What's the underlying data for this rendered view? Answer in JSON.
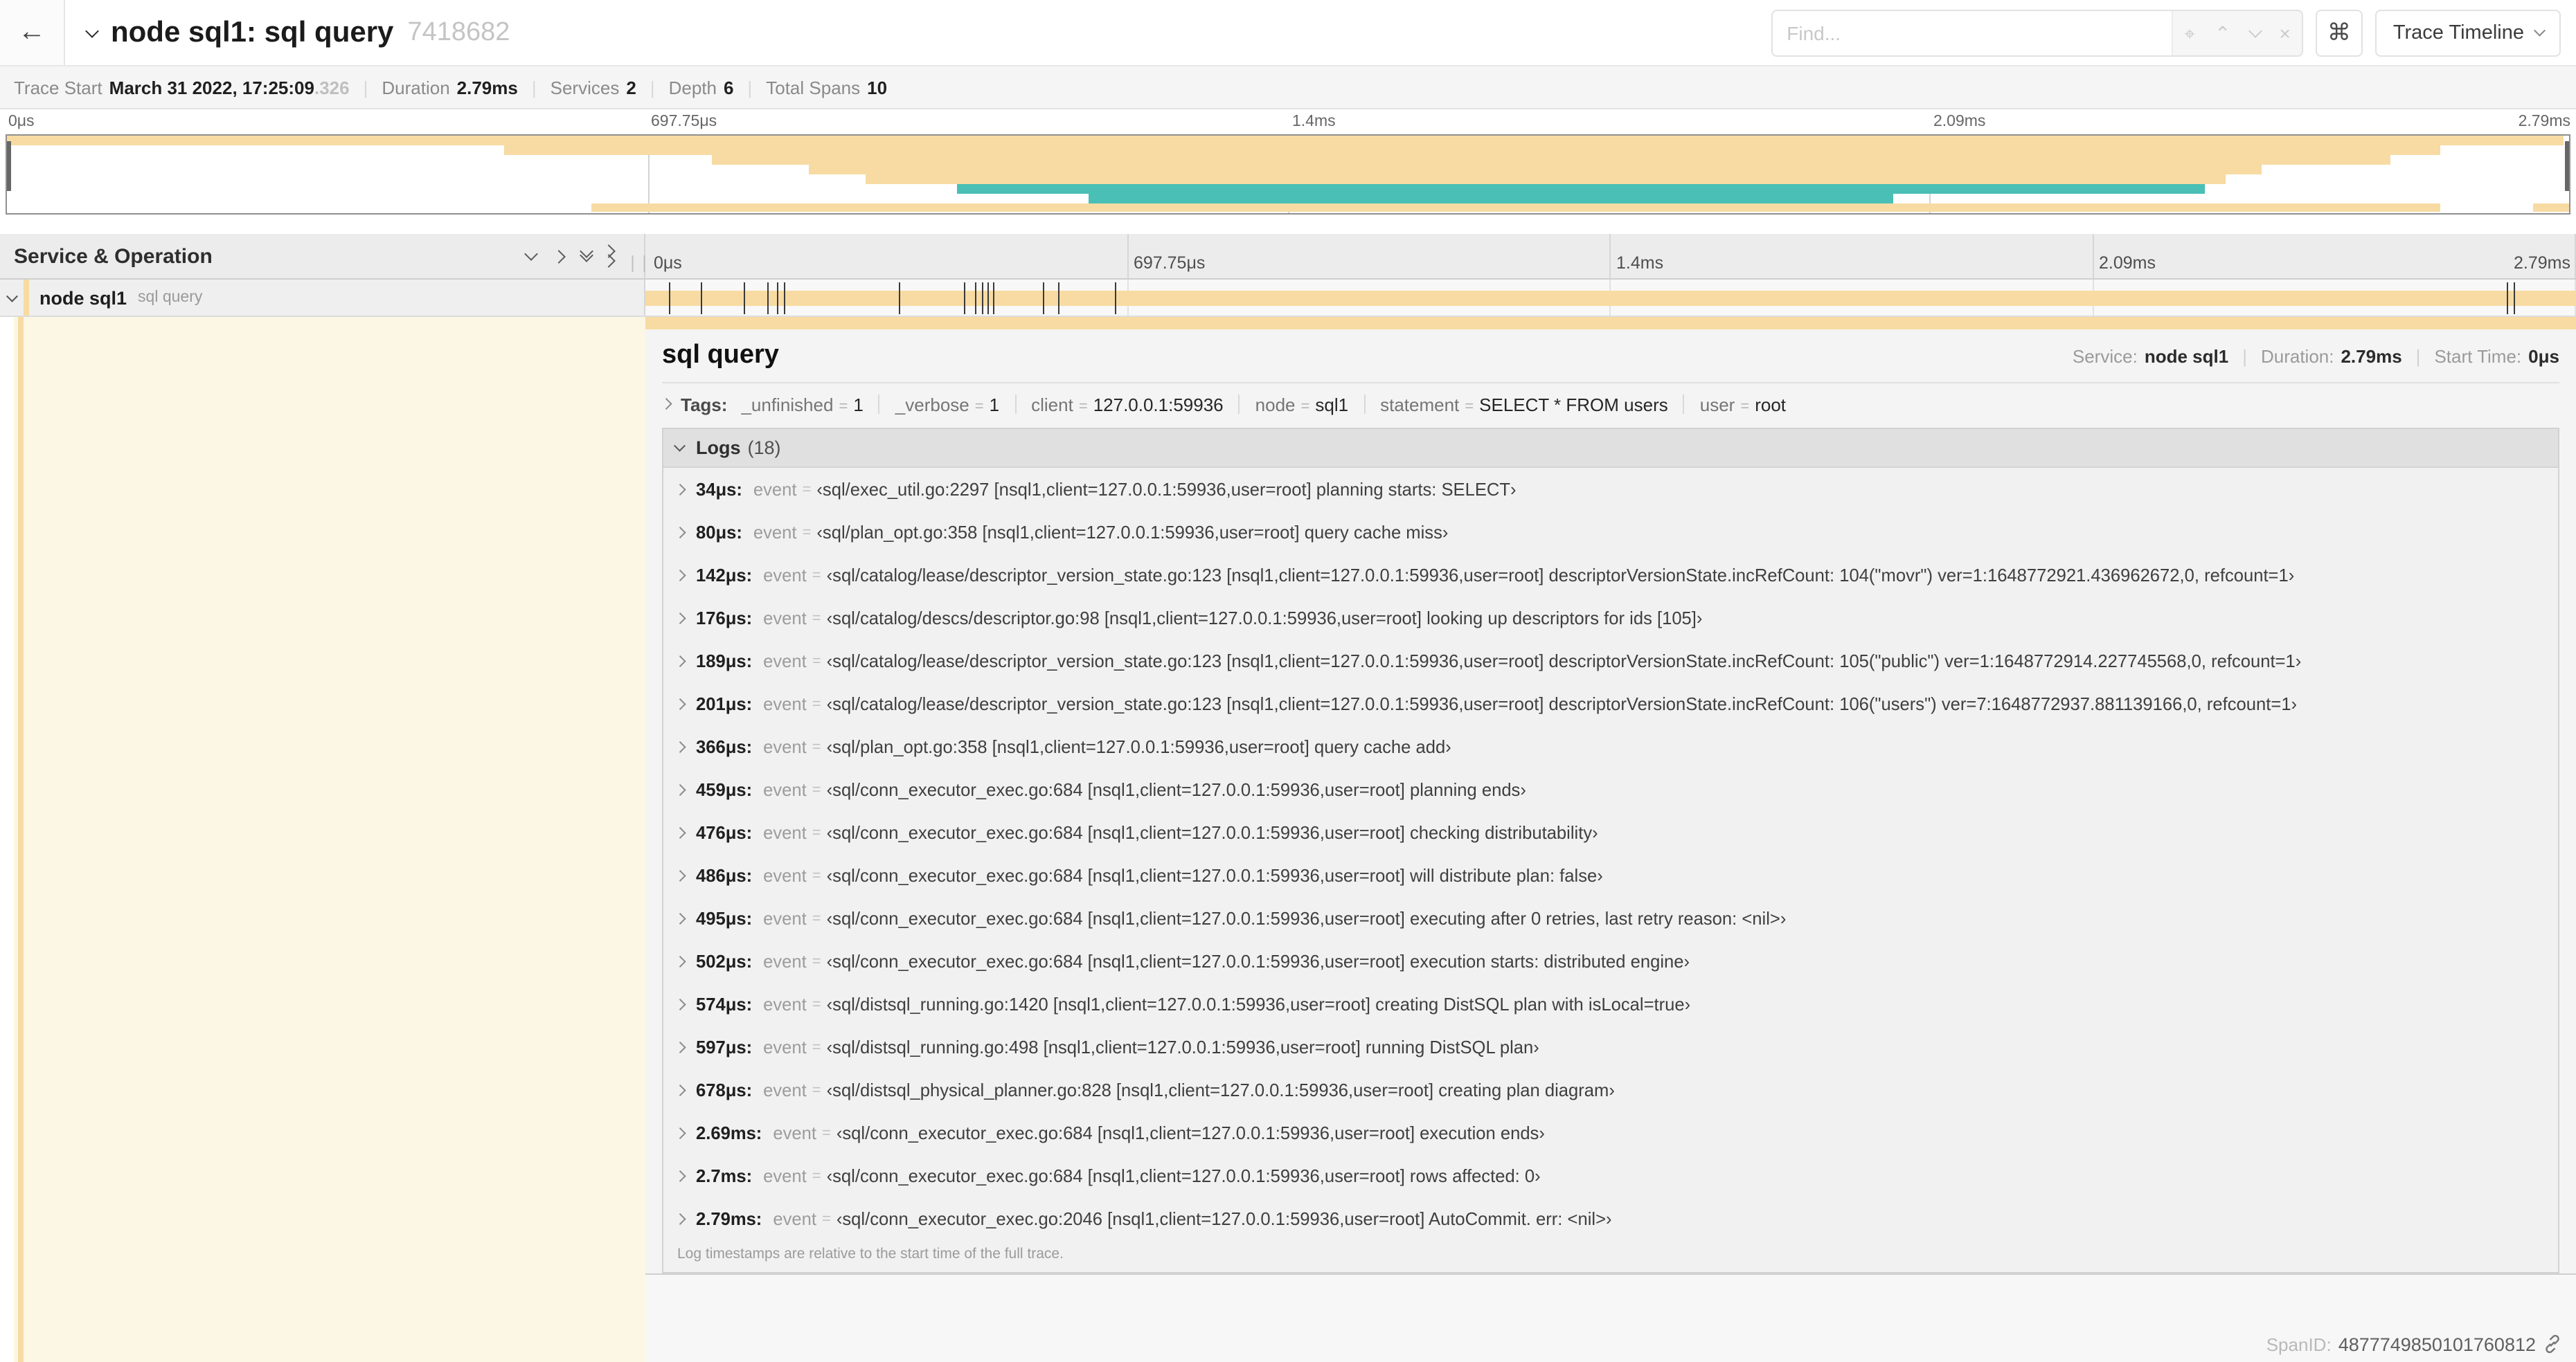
{
  "header": {
    "back_icon": "←",
    "title": "node sql1: sql query",
    "trace_id": "7418682",
    "find_placeholder": "Find...",
    "shortcut_key": "⌘",
    "view_selector": "Trace Timeline"
  },
  "trace_info": {
    "items": [
      {
        "label": "Trace Start",
        "value": "March 31 2022, 17:25:09",
        "suffix": ".326"
      },
      {
        "label": "Duration",
        "value": "2.79ms"
      },
      {
        "label": "Services",
        "value": "2"
      },
      {
        "label": "Depth",
        "value": "6"
      },
      {
        "label": "Total Spans",
        "value": "10"
      }
    ]
  },
  "colors": {
    "tan": "#F7DBA2",
    "teal": "#49BFB5",
    "beige": "#FCF6E4"
  },
  "axis": {
    "labels": [
      {
        "label": "0μs",
        "pct": 0
      },
      {
        "label": "697.75μs",
        "pct": 25
      },
      {
        "label": "1.4ms",
        "pct": 50
      },
      {
        "label": "2.09ms",
        "pct": 75
      },
      {
        "label": "2.79ms",
        "pct": 100
      }
    ]
  },
  "minimap": {
    "bars": [
      {
        "row": 0,
        "start": 0,
        "end": 99.8,
        "color": "tan"
      },
      {
        "row": 1,
        "start": 19.4,
        "end": 95.0,
        "color": "tan"
      },
      {
        "row": 2,
        "start": 27.5,
        "end": 93.0,
        "color": "tan"
      },
      {
        "row": 3,
        "start": 31.3,
        "end": 88.0,
        "color": "tan"
      },
      {
        "row": 4,
        "start": 33.5,
        "end": 86.6,
        "color": "tan"
      },
      {
        "row": 5,
        "start": 37.1,
        "end": 85.8,
        "color": "teal"
      },
      {
        "row": 6,
        "start": 42.2,
        "end": 73.6,
        "color": "teal"
      },
      {
        "row": 7,
        "start": 22.8,
        "end": 95.0,
        "color": "tan"
      },
      {
        "row": 7,
        "start": 98.6,
        "end": 100,
        "color": "tan"
      }
    ]
  },
  "timeline": {
    "column_header": "Service & Operation",
    "span_row": {
      "service": "node sql1",
      "operation": "sql query",
      "bar_start_pct": 0,
      "bar_end_pct": 100,
      "log_tick_pcts": [
        1.2,
        2.9,
        5.1,
        6.3,
        6.8,
        7.2,
        13.1,
        16.5,
        17.1,
        17.4,
        17.7,
        18.0,
        20.6,
        21.4,
        24.3,
        96.4,
        96.8
      ]
    }
  },
  "detail": {
    "operation": "sql query",
    "summary": [
      {
        "label": "Service:",
        "value": "node sql1"
      },
      {
        "label": "Duration:",
        "value": "2.79ms"
      },
      {
        "label": "Start Time:",
        "value": "0μs"
      }
    ],
    "tags": {
      "label": "Tags:",
      "items": [
        {
          "key": "_unfinished",
          "value": "1"
        },
        {
          "key": "_verbose",
          "value": "1"
        },
        {
          "key": "client",
          "value": "127.0.0.1:59936"
        },
        {
          "key": "node",
          "value": "sql1"
        },
        {
          "key": "statement",
          "value": "SELECT * FROM users"
        },
        {
          "key": "user",
          "value": "root"
        }
      ]
    },
    "logs": {
      "label": "Logs",
      "count": "(18)",
      "rows": [
        {
          "time": "34μs:",
          "key": "event",
          "value": "‹sql/exec_util.go:2297 [nsql1,client=127.0.0.1:59936,user=root] planning starts: SELECT›"
        },
        {
          "time": "80μs:",
          "key": "event",
          "value": "‹sql/plan_opt.go:358 [nsql1,client=127.0.0.1:59936,user=root] query cache miss›"
        },
        {
          "time": "142μs:",
          "key": "event",
          "value": "‹sql/catalog/lease/descriptor_version_state.go:123 [nsql1,client=127.0.0.1:59936,user=root] descriptorVersionState.incRefCount: 104(\"movr\") ver=1:1648772921.436962672,0, refcount=1›"
        },
        {
          "time": "176μs:",
          "key": "event",
          "value": "‹sql/catalog/descs/descriptor.go:98 [nsql1,client=127.0.0.1:59936,user=root] looking up descriptors for ids [105]›"
        },
        {
          "time": "189μs:",
          "key": "event",
          "value": "‹sql/catalog/lease/descriptor_version_state.go:123 [nsql1,client=127.0.0.1:59936,user=root] descriptorVersionState.incRefCount: 105(\"public\") ver=1:1648772914.227745568,0, refcount=1›"
        },
        {
          "time": "201μs:",
          "key": "event",
          "value": "‹sql/catalog/lease/descriptor_version_state.go:123 [nsql1,client=127.0.0.1:59936,user=root] descriptorVersionState.incRefCount: 106(\"users\") ver=7:1648772937.881139166,0, refcount=1›"
        },
        {
          "time": "366μs:",
          "key": "event",
          "value": "‹sql/plan_opt.go:358 [nsql1,client=127.0.0.1:59936,user=root] query cache add›"
        },
        {
          "time": "459μs:",
          "key": "event",
          "value": "‹sql/conn_executor_exec.go:684 [nsql1,client=127.0.0.1:59936,user=root] planning ends›"
        },
        {
          "time": "476μs:",
          "key": "event",
          "value": "‹sql/conn_executor_exec.go:684 [nsql1,client=127.0.0.1:59936,user=root] checking distributability›"
        },
        {
          "time": "486μs:",
          "key": "event",
          "value": "‹sql/conn_executor_exec.go:684 [nsql1,client=127.0.0.1:59936,user=root] will distribute plan: false›"
        },
        {
          "time": "495μs:",
          "key": "event",
          "value": "‹sql/conn_executor_exec.go:684 [nsql1,client=127.0.0.1:59936,user=root] executing after 0 retries, last retry reason: <nil>›"
        },
        {
          "time": "502μs:",
          "key": "event",
          "value": "‹sql/conn_executor_exec.go:684 [nsql1,client=127.0.0.1:59936,user=root] execution starts: distributed engine›"
        },
        {
          "time": "574μs:",
          "key": "event",
          "value": "‹sql/distsql_running.go:1420 [nsql1,client=127.0.0.1:59936,user=root] creating DistSQL plan with isLocal=true›"
        },
        {
          "time": "597μs:",
          "key": "event",
          "value": "‹sql/distsql_running.go:498 [nsql1,client=127.0.0.1:59936,user=root] running DistSQL plan›"
        },
        {
          "time": "678μs:",
          "key": "event",
          "value": "‹sql/distsql_physical_planner.go:828 [nsql1,client=127.0.0.1:59936,user=root] creating plan diagram›"
        },
        {
          "time": "2.69ms:",
          "key": "event",
          "value": "‹sql/conn_executor_exec.go:684 [nsql1,client=127.0.0.1:59936,user=root] execution ends›"
        },
        {
          "time": "2.7ms:",
          "key": "event",
          "value": "‹sql/conn_executor_exec.go:684 [nsql1,client=127.0.0.1:59936,user=root] rows affected: 0›"
        },
        {
          "time": "2.79ms:",
          "key": "event",
          "value": "‹sql/conn_executor_exec.go:2046 [nsql1,client=127.0.0.1:59936,user=root] AutoCommit. err: <nil>›"
        }
      ]
    },
    "footer_note": "Log timestamps are relative to the start time of the full trace.",
    "span_id_label": "SpanID:",
    "span_id": "4877749850101760812"
  }
}
